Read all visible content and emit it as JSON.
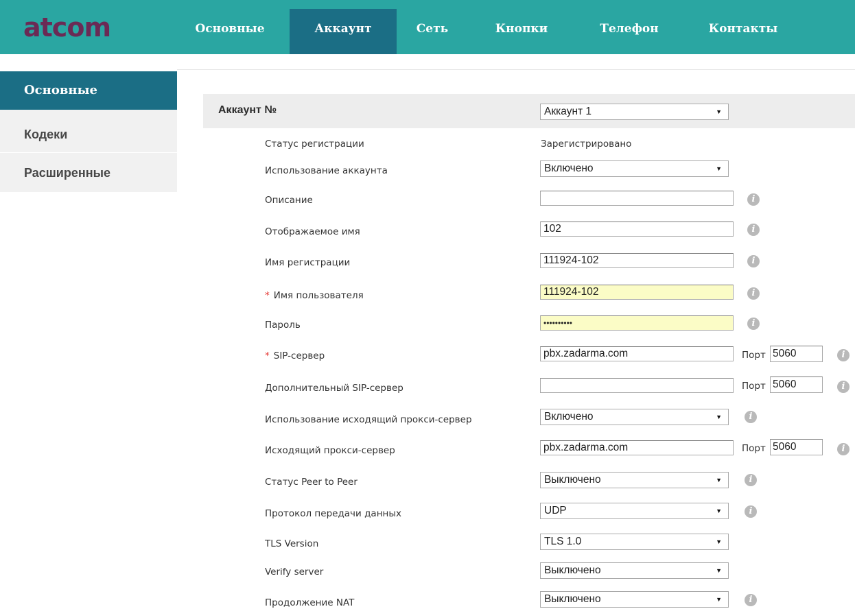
{
  "brand": {
    "logo_text": "atcom",
    "logo_color": "#6b2a55",
    "nav_color": "#2aa6a2",
    "active_color": "#1b6e85"
  },
  "nav": {
    "items": [
      {
        "label": "Основные"
      },
      {
        "label": "Аккаунт",
        "active": true
      },
      {
        "label": "Сеть"
      },
      {
        "label": "Кнопки"
      },
      {
        "label": "Телефон"
      },
      {
        "label": "Контакты"
      }
    ]
  },
  "sidebar": {
    "items": [
      {
        "label": "Основные",
        "active": true
      },
      {
        "label": "Кодеки"
      },
      {
        "label": "Расширенные"
      }
    ]
  },
  "account": {
    "label": "Аккаунт №",
    "selected": "Аккаунт 1"
  },
  "form": {
    "registration_status": {
      "label": "Статус регистрации",
      "value": "Зарегистрировано"
    },
    "account_usage": {
      "label": "Использование аккаунта",
      "value": "Включено"
    },
    "description": {
      "label": "Описание",
      "value": ""
    },
    "display_name": {
      "label": "Отображаемое имя",
      "value": "102"
    },
    "register_name": {
      "label": "Имя регистрации",
      "value": "111924-102"
    },
    "username": {
      "label": "Имя пользователя",
      "value": "111924-102",
      "required_mark": "*"
    },
    "password": {
      "label": "Пароль",
      "value": "••••••••••"
    },
    "sip_server": {
      "label": "SIP-сервер",
      "value": "pbx.zadarma.com",
      "required_mark": "*",
      "port_label": "Порт",
      "port": "5060"
    },
    "backup_sip_server": {
      "label": "Дополнительный SIP-сервер",
      "value": "",
      "port_label": "Порт",
      "port": "5060"
    },
    "outbound_proxy_usage": {
      "label": "Использование исходящий прокси-сервер",
      "value": "Включено"
    },
    "outbound_proxy": {
      "label": "Исходящий прокси-сервер",
      "value": "pbx.zadarma.com",
      "port_label": "Порт",
      "port": "5060"
    },
    "peer_to_peer": {
      "label": "Статус Peer to Peer",
      "value": "Выключено"
    },
    "transport": {
      "label": "Протокол передачи данных",
      "value": "UDP"
    },
    "tls_version": {
      "label": "TLS Version",
      "value": "TLS 1.0"
    },
    "verify_server": {
      "label": "Verify server",
      "value": "Выключено"
    },
    "nat_keepalive": {
      "label": "Продолжение NAT",
      "value": "Выключено"
    }
  },
  "icons": {
    "info": "info-icon",
    "info_glyph": "i",
    "dropdown": "▼"
  }
}
